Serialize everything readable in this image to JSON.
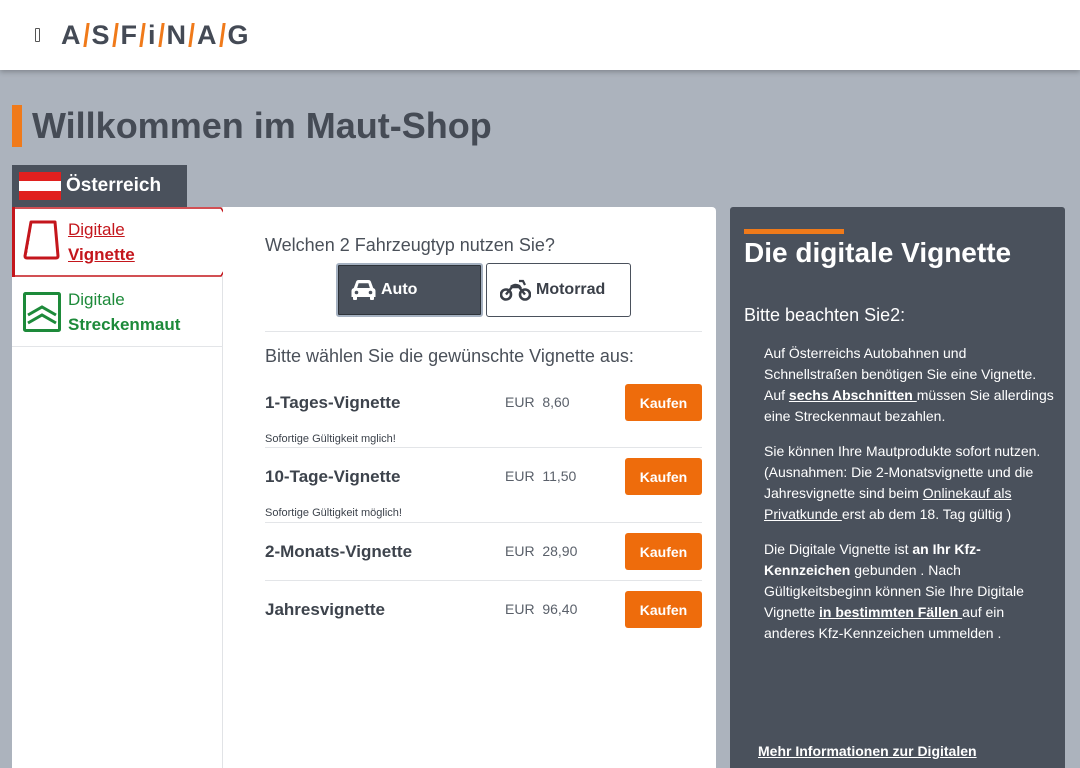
{
  "header": {
    "logo_letters": [
      "A",
      "S",
      "F",
      "i",
      "N",
      "A",
      "G"
    ]
  },
  "page": {
    "title": "Willkommen im Maut-Shop"
  },
  "country_tab": {
    "label": "Österreich"
  },
  "sidebar": {
    "vignette": {
      "line1": "Digitale",
      "line2": "Vignette"
    },
    "strecke": {
      "line1": "Digitale",
      "line2": "Streckenmaut"
    }
  },
  "main": {
    "question": "Welchen 2 Fahrzeugtyp nutzen Sie?",
    "vehicle_auto": "Auto",
    "vehicle_moto": "Motorrad",
    "select_label": "Bitte wählen Sie die gewünschte Vignette aus:",
    "products": [
      {
        "name": "1-Tages-Vignette",
        "currency": "EUR",
        "price": "8,60",
        "note": "Sofortige Gültigkeit mglich!",
        "buy": "Kaufen"
      },
      {
        "name": "10-Tage-Vignette",
        "currency": "EUR",
        "price": "11,50",
        "note": "Sofortige Gültigkeit möglich!",
        "buy": "Kaufen"
      },
      {
        "name": "2-Monats-Vignette",
        "currency": "EUR",
        "price": "28,90",
        "note": "",
        "buy": "Kaufen"
      },
      {
        "name": "Jahresvignette",
        "currency": "EUR",
        "price": "96,40",
        "note": "",
        "buy": "Kaufen"
      }
    ]
  },
  "info": {
    "title": "Die digitale Vignette",
    "subtitle": "Bitte beachten Sie2:",
    "p1_a": "Auf Österreichs Autobahnen und Schnellstraßen benötigen Sie eine Vignette. Auf ",
    "p1_link": "sechs Abschnitten ",
    "p1_b": "müssen Sie allerdings eine Streckenmaut bezahlen.",
    "p2_a": "Sie können Ihre Mautprodukte sofort nutzen. (Ausnahmen: Die 2-Monatsvignette und die Jahresvignette sind beim ",
    "p2_link": "Onlinekauf als Privatkunde ",
    "p2_b": "erst ab dem 18. Tag gültig )",
    "p3_a": "Die Digitale Vignette ist ",
    "p3_bold": "an Ihr Kfz-Kennzeichen",
    "p3_b": " gebunden . Nach Gültigkeitsbeginn können Sie Ihre Digitale Vignette ",
    "p3_link": "in bestimmten Fällen ",
    "p3_c": "auf ein anderes Kfz-Kennzeichen ummelden .",
    "more_link": "Mehr Informationen zur Digitalen"
  },
  "colors": {
    "accent_orange": "#f07a1a",
    "buy_orange": "#ee6c0c",
    "vignette_red": "#c4161c",
    "strecke_green": "#1d8a3a",
    "panel_dark": "#4a515c",
    "page_bg": "#acb3bd"
  }
}
